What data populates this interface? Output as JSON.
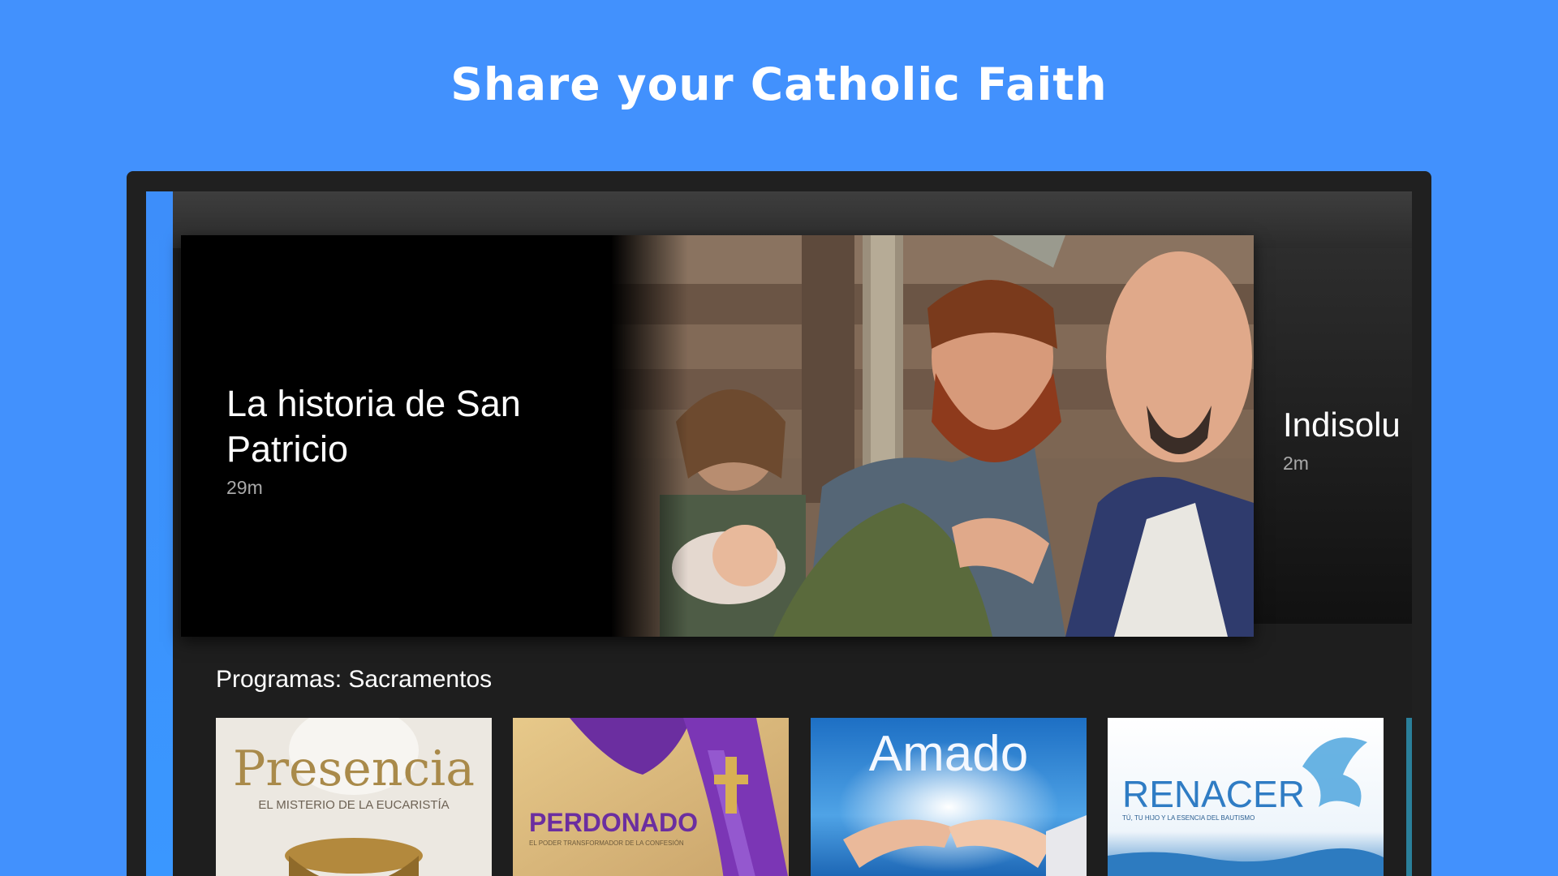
{
  "headline": "Share your Catholic Faith",
  "hero": {
    "title": "La historia de San Patricio",
    "duration": "29m"
  },
  "next_item": {
    "title": "Indisolu",
    "duration": "2m"
  },
  "row": {
    "title": "Programas: Sacramentos",
    "tiles": [
      {
        "title": "Presencia",
        "subtitle": "EL MISTERIO DE LA EUCARISTÍA"
      },
      {
        "title": "PERDONADO",
        "subtitle": "EL PODER TRANSFORMADOR DE LA CONFESIÓN"
      },
      {
        "title": "Amado",
        "subtitle": ""
      },
      {
        "title": "RENACER",
        "subtitle": "TÚ, TU HIJO Y LA ESENCIA DEL BAUTISMO"
      }
    ]
  },
  "colors": {
    "background": "#4291fd",
    "rail": "#3a97ff",
    "device_frame": "#202020"
  }
}
